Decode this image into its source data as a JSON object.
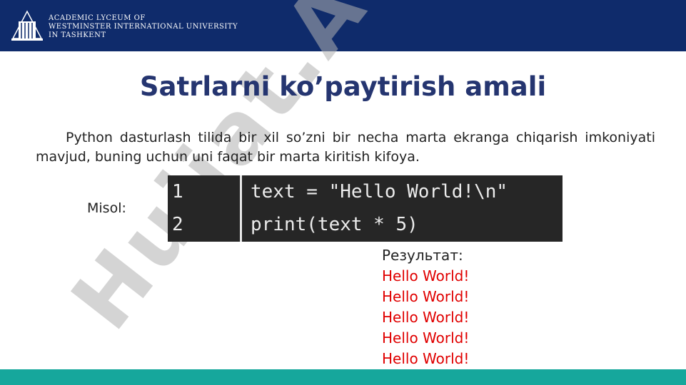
{
  "header": {
    "brand_lines": [
      "ACADEMIC LYCEUM OF",
      "WESTMINSTER INTERNATIONAL UNIVERSITY",
      "IN TASHKENT"
    ],
    "background": "#0f2b6b"
  },
  "watermark": {
    "text": "Hujjat.A",
    "color": "#b0b0b0"
  },
  "slide": {
    "title": "Satrlarni ko’paytirish amali",
    "paragraph": "Python dasturlash tilida bir xil so’zni bir necha marta ekranga chiqarish imkoniyati mavjud, buning uchun uni faqat bir marta kiritish kifoya.",
    "example_label": "Misol:",
    "code_lines": [
      {
        "num": "1",
        "code": "text = \"Hello World!\\n\""
      },
      {
        "num": "2",
        "code": "print(text * 5)"
      }
    ],
    "result_label": "Результат:",
    "result_lines": [
      "Hello World!",
      "Hello World!",
      "Hello World!",
      "Hello World!",
      "Hello World!"
    ]
  },
  "colors": {
    "title": "#253570",
    "result": "#e00000",
    "footer": "#16a79c",
    "code_bg": "#262626"
  }
}
